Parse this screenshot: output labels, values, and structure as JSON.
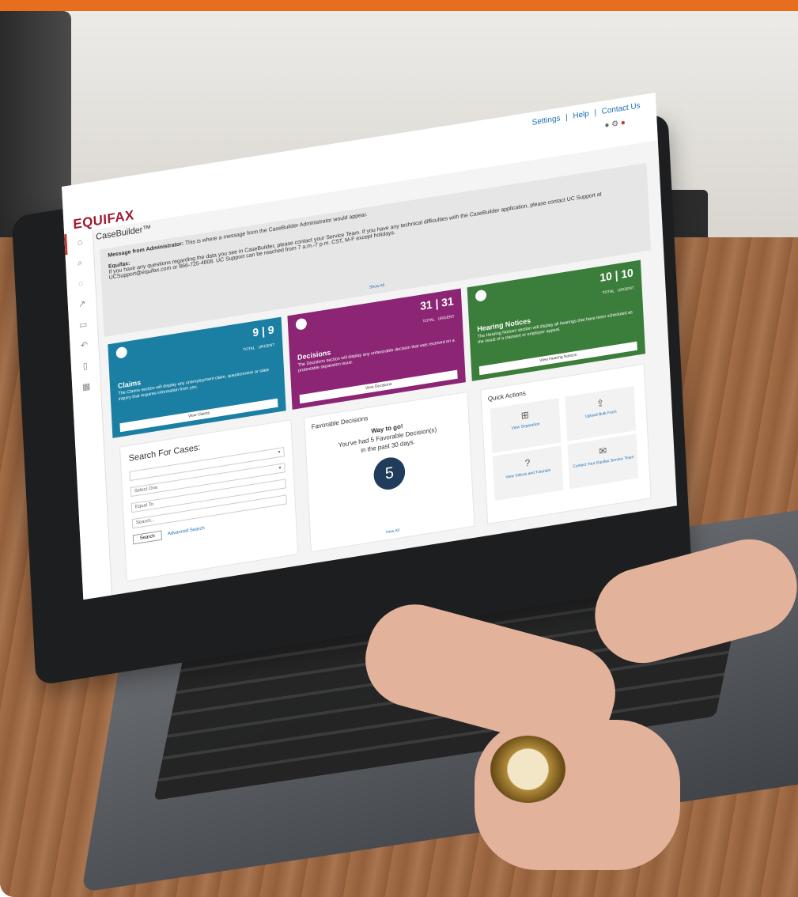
{
  "colors": {
    "brand": "#9e1b32",
    "claims": "#1a7fa3",
    "decisions": "#8b2574",
    "hearing": "#3b7d3a",
    "accent_bar": "#e66e1e"
  },
  "header": {
    "logo": "EQUIFAX",
    "links": [
      "Settings",
      "|",
      "Help",
      "|",
      "Contact Us"
    ]
  },
  "sidebar": {
    "icons": [
      "home-icon",
      "search-icon",
      "chat-icon",
      "share-icon",
      "print-icon",
      "undo-icon",
      "trash-icon",
      "grid-icon"
    ]
  },
  "page": {
    "title": "CaseBuilder™"
  },
  "message": {
    "title": "Message from Administrator:",
    "body": "This is where a message from the CaseBuilder Administrator would appear.",
    "equifax_label": "Equifax:",
    "equifax_body": "If you have any questions regarding the data you see in CaseBuilder, please contact your Service Team. If you have any technical difficulties with the CaseBuilder application, please contact UC Support at UCSupport@equifax.com or 866-725-4808. UC Support can be reached from 7 a.m.-7 p.m. CST, M-F except holidays.",
    "show_all": "Show All"
  },
  "cards": [
    {
      "title": "Claims",
      "total": "9",
      "urgent": "9",
      "total_label": "TOTAL",
      "urgent_label": "URGENT",
      "desc": "The Claims section will display any unemployment claim, questionnaire or state inquiry that requires information from you.",
      "button": "View Claims"
    },
    {
      "title": "Decisions",
      "total": "31",
      "urgent": "31",
      "total_label": "TOTAL",
      "urgent_label": "URGENT",
      "desc": "The Decisions section will display any unfavorable decision that was received on a protestable separation issue.",
      "button": "View Decisions"
    },
    {
      "title": "Hearing Notices",
      "total": "10",
      "urgent": "10",
      "total_label": "TOTAL",
      "urgent_label": "URGENT",
      "desc": "The Hearing Notices section will display all hearings that have been scheduled as the result of a claimant or employer appeal.",
      "button": "View Hearing Notices"
    }
  ],
  "search": {
    "title": "Search For Cases:",
    "select_one": "Select One",
    "equal_to": "Equal To",
    "search_placeholder": "Search...",
    "search_button": "Search",
    "advanced_link": "Advanced Search"
  },
  "favorable": {
    "title": "Favorable Decisions",
    "line1": "Way to go!",
    "line2": "You've had 5 Favorable Decision(s)",
    "line3": "in the past 30 days.",
    "count": "5",
    "view_all": "View All"
  },
  "quick_actions": {
    "title": "Quick Actions",
    "items": [
      {
        "label": "View Separation",
        "icon": "plus-box-icon"
      },
      {
        "label": "Upload Bulk Form",
        "icon": "upload-icon"
      },
      {
        "label": "View Videos and Tutorials",
        "icon": "question-icon"
      },
      {
        "label": "Contact Your Equifax Service Team",
        "icon": "mail-icon"
      }
    ]
  }
}
